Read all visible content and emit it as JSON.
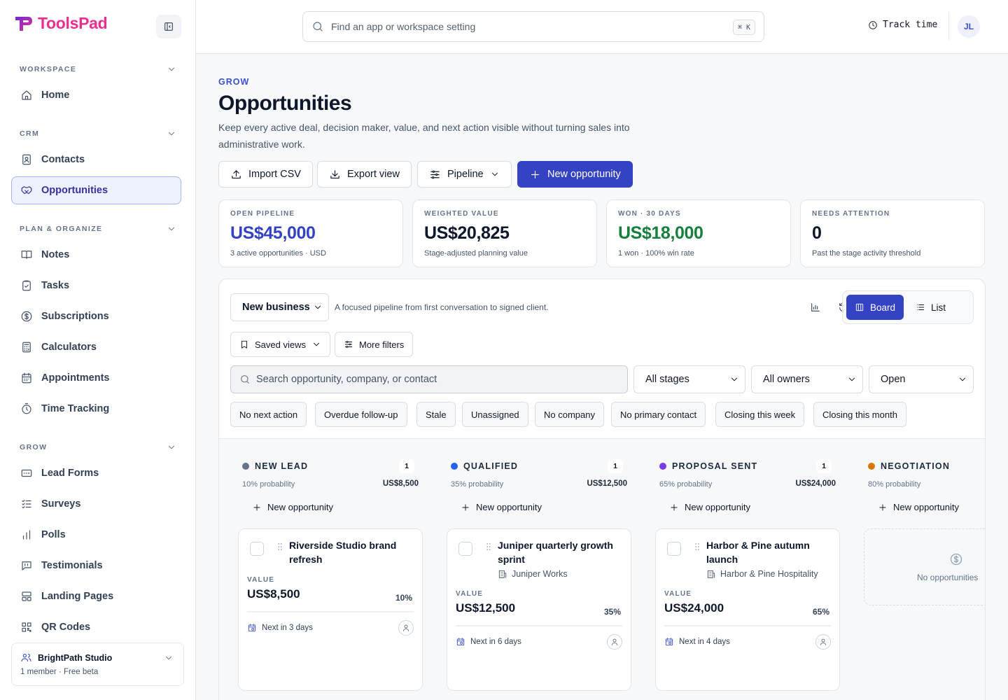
{
  "app": {
    "name": "ToolsPad",
    "collapse_label": "Collapse sidebar"
  },
  "sidebar": {
    "sections": [
      {
        "title": "WORKSPACE",
        "items": [
          {
            "label": "Home",
            "icon": "home-icon"
          }
        ]
      },
      {
        "title": "CRM",
        "items": [
          {
            "label": "Contacts",
            "icon": "contacts-icon"
          },
          {
            "label": "Opportunities",
            "icon": "handshake-icon",
            "active": true
          }
        ]
      },
      {
        "title": "PLAN & ORGANIZE",
        "items": [
          {
            "label": "Notes",
            "icon": "notes-icon"
          },
          {
            "label": "Tasks",
            "icon": "clipboard-check-icon"
          },
          {
            "label": "Subscriptions",
            "icon": "dollar-circle-icon"
          },
          {
            "label": "Calculators",
            "icon": "calculator-icon"
          },
          {
            "label": "Appointments",
            "icon": "calendar-icon"
          },
          {
            "label": "Time Tracking",
            "icon": "stopwatch-icon"
          }
        ]
      },
      {
        "title": "GROW",
        "items": [
          {
            "label": "Lead Forms",
            "icon": "form-icon"
          },
          {
            "label": "Surveys",
            "icon": "checklist-icon"
          },
          {
            "label": "Polls",
            "icon": "bar-chart-icon"
          },
          {
            "label": "Testimonials",
            "icon": "quote-icon"
          },
          {
            "label": "Landing Pages",
            "icon": "layout-icon"
          },
          {
            "label": "QR Codes",
            "icon": "qr-code-icon"
          }
        ]
      }
    ],
    "workspace": {
      "name": "BrightPath Studio",
      "meta": "1 member · Free beta"
    }
  },
  "topbar": {
    "search_placeholder": "Find an app or workspace setting",
    "shortcut": "⌘ K",
    "track_label": "Track time",
    "avatar_initials": "JL"
  },
  "page": {
    "eyebrow": "GROW",
    "title": "Opportunities",
    "description": "Keep every active deal, decision maker, value, and next action visible without turning sales into administrative work.",
    "actions": {
      "import": "Import CSV",
      "export": "Export view",
      "pipeline": "Pipeline",
      "new": "New opportunity"
    }
  },
  "stats": [
    {
      "label": "OPEN PIPELINE",
      "value": "US$45,000",
      "sub": "3 active opportunities · USD",
      "color": "#3442c4"
    },
    {
      "label": "WEIGHTED VALUE",
      "value": "US$20,825",
      "sub": "Stage-adjusted planning value",
      "color": "#0f172a"
    },
    {
      "label": "WON · 30 DAYS",
      "value": "US$18,000",
      "sub": "1 won · 100% win rate",
      "color": "#15803d"
    },
    {
      "label": "NEEDS ATTENTION",
      "value": "0",
      "sub": "Past the stage activity threshold",
      "color": "#0f172a"
    }
  ],
  "toolbar": {
    "pipeline_select": "New business",
    "pipeline_desc": "A focused pipeline from first conversation to signed client.",
    "view_board": "Board",
    "view_list": "List",
    "saved_views": "Saved views",
    "more_filters": "More filters",
    "search_placeholder": "Search opportunity, company, or contact",
    "stage_filter": "All stages",
    "owner_filter": "All owners",
    "status_filter": "Open",
    "chips": [
      "No next action",
      "Overdue follow-up",
      "Stale",
      "Unassigned",
      "No company",
      "No primary contact",
      "Closing this week",
      "Closing this month"
    ]
  },
  "board": {
    "add_label": "New opportunity",
    "columns": [
      {
        "name": "NEW LEAD",
        "count": "1",
        "probability": "10% probability",
        "total": "US$8,500",
        "color": "#64748b",
        "card": {
          "title": "Riverside Studio brand refresh",
          "company": "",
          "value_label": "VALUE",
          "value": "US$8,500",
          "prob": "10%",
          "next": "Next in 3 days"
        }
      },
      {
        "name": "QUALIFIED",
        "count": "1",
        "probability": "35% probability",
        "total": "US$12,500",
        "color": "#2563eb",
        "card": {
          "title": "Juniper quarterly growth sprint",
          "company": "Juniper Works",
          "value_label": "VALUE",
          "value": "US$12,500",
          "prob": "35%",
          "next": "Next in 6 days"
        }
      },
      {
        "name": "PROPOSAL SENT",
        "count": "1",
        "probability": "65% probability",
        "total": "US$24,000",
        "color": "#7c3aed",
        "card": {
          "title": "Harbor & Pine autumn launch",
          "company": "Harbor & Pine Hospitality",
          "value_label": "VALUE",
          "value": "US$24,000",
          "prob": "65%",
          "next": "Next in 4 days"
        }
      },
      {
        "name": "NEGOTIATION",
        "count": "",
        "probability": "80% probability",
        "total": "",
        "color": "#d97706",
        "empty": "No opportunities"
      }
    ]
  }
}
